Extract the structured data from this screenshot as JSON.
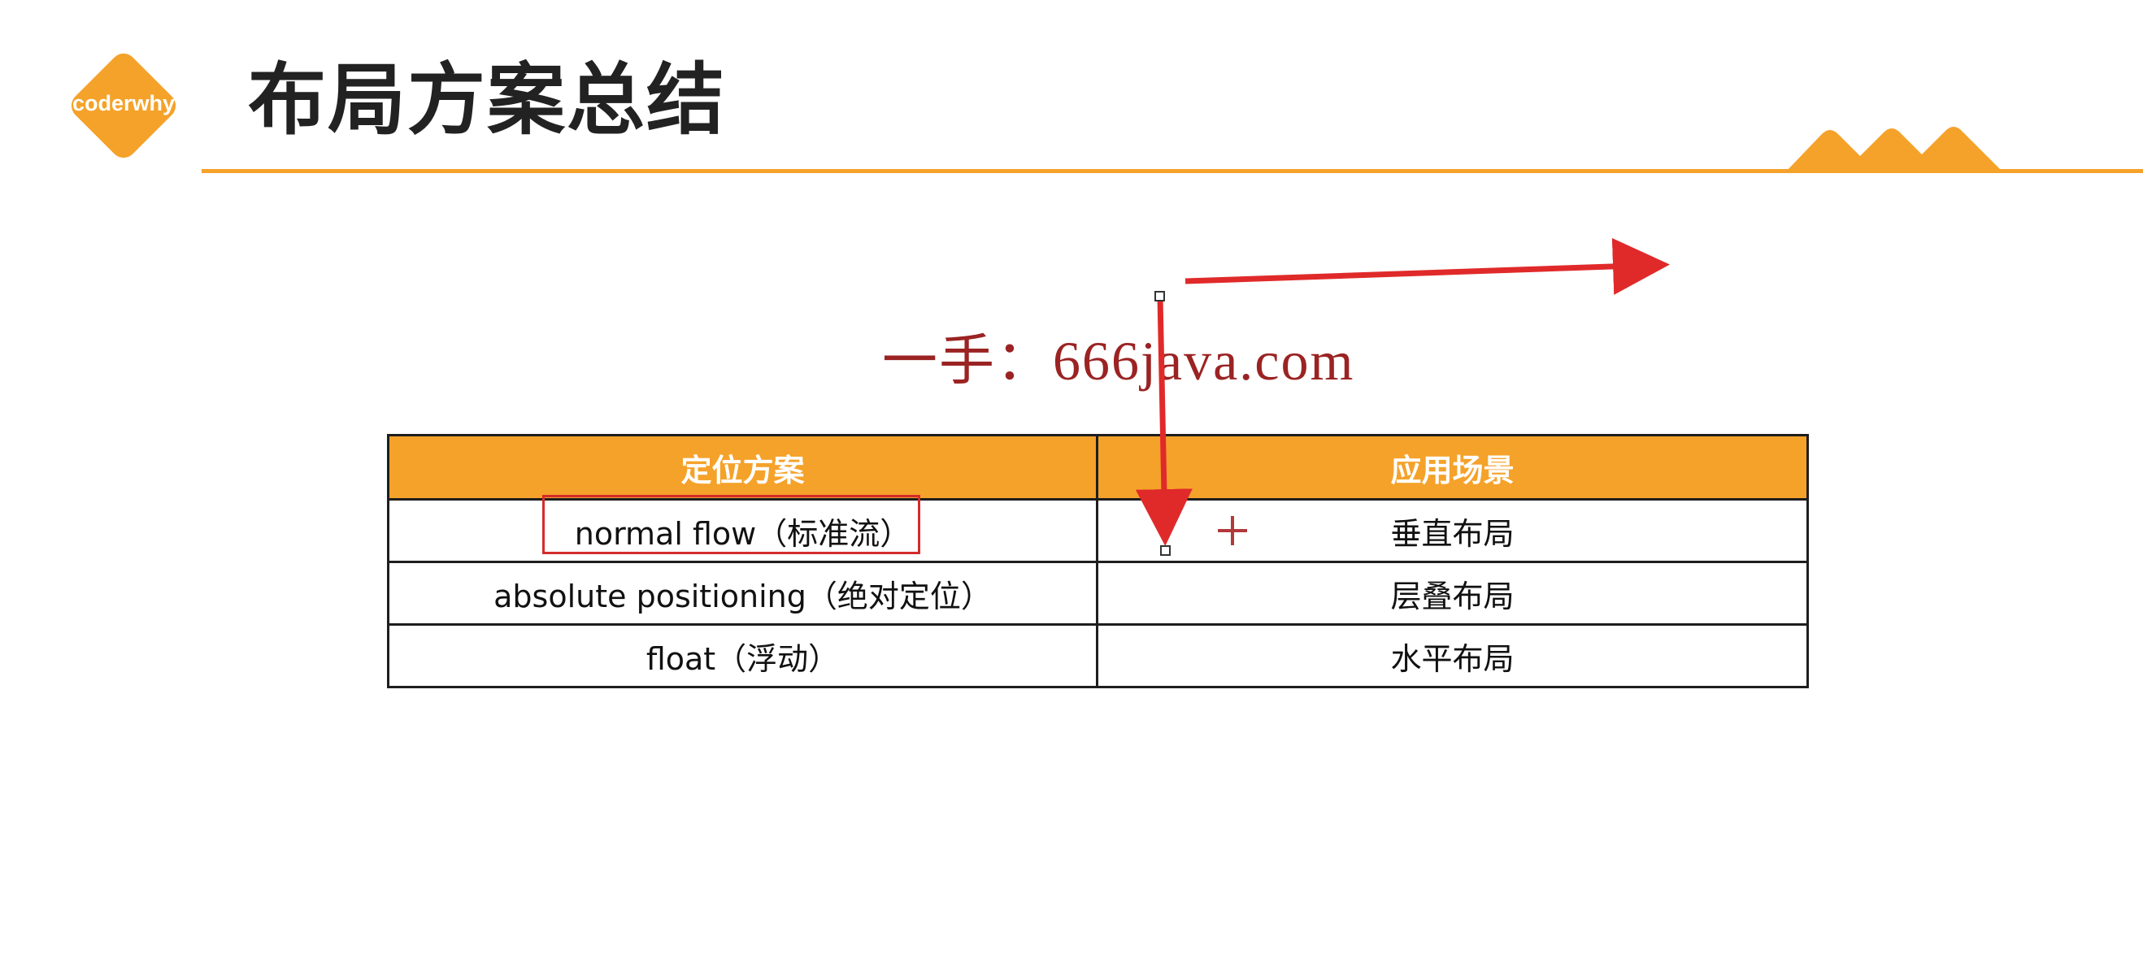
{
  "header": {
    "logo_text": "coderwhy",
    "title": "布局方案总结"
  },
  "watermark": "一手：666java.com",
  "table": {
    "headers": [
      "定位方案",
      "应用场景"
    ],
    "rows": [
      [
        "normal flow（标准流）",
        "垂直布局"
      ],
      [
        "absolute positioning（绝对定位）",
        "层叠布局"
      ],
      [
        "float（浮动）",
        "水平布局"
      ]
    ]
  },
  "colors": {
    "accent": "#f5a22a",
    "title": "#222222",
    "annotation": "#e02a2a",
    "watermark": "#9b2323"
  },
  "icons": [
    "logo-diamond-icon",
    "mountains-icon",
    "arrow-right-icon",
    "arrow-down-icon",
    "crosshair-cursor-icon"
  ]
}
